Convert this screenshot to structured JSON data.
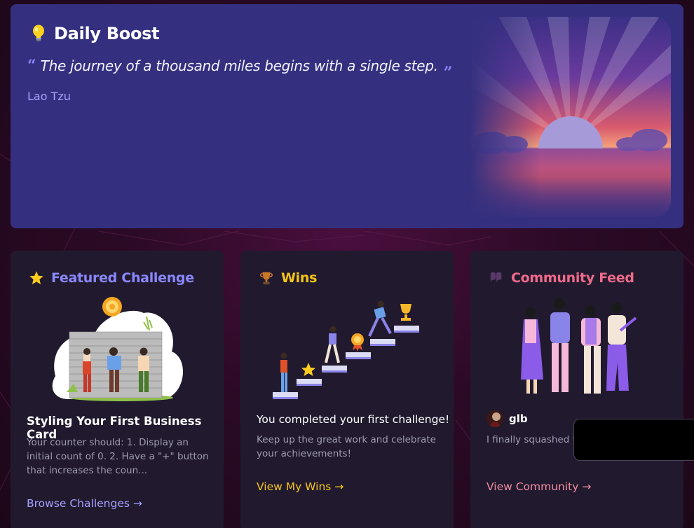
{
  "daily_boost": {
    "title": "Daily Boost",
    "icon": "lightbulb-icon",
    "quote_open": "“",
    "quote": "The journey of a thousand miles begins with a single step.",
    "quote_close": "”",
    "author": "Lao Tzu"
  },
  "cards": [
    {
      "icon": "star-icon",
      "title": "Featured Challenge",
      "title_color": "#8b87ff",
      "subtitle": "Styling Your First Business Card",
      "body": "Your counter should: 1. Display an initial count of 0. 2. Have a \"+\" button that increases the coun...",
      "link": "Browse Challenges →",
      "link_color": "#a5a1ff"
    },
    {
      "icon": "trophy-icon",
      "title": "Wins",
      "title_color": "#f5c518",
      "subtitle": "You completed your first challenge!",
      "body": "Keep up the great work and celebrate your achievements!",
      "link": "View My Wins →",
      "link_color": "#f5c518"
    },
    {
      "icon": "speech-bubbles-icon",
      "title": "Community Feed",
      "title_color": "#f06a8a",
      "user": "glb",
      "body": "I finally squashed th tripping me up!",
      "link": "View Community →",
      "link_color": "#f28ba3"
    }
  ],
  "colors": {
    "background": "#2b0a26",
    "boost_panel": "#34307f",
    "card": "#211a2e",
    "accent_purple": "#8b87ff",
    "accent_gold": "#f5c518",
    "accent_pink": "#f06a8a"
  }
}
